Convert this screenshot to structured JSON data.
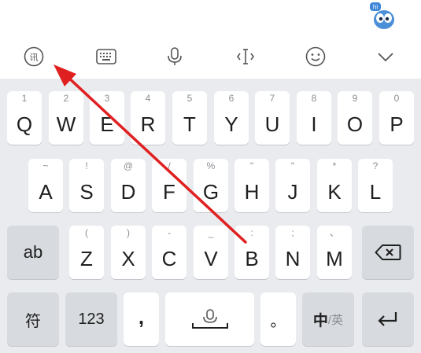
{
  "toolbar": {
    "icons": [
      "handwriting-input-icon",
      "keyboard-icon",
      "microphone-icon",
      "cursor-move-icon",
      "emoji-icon",
      "collapse-icon"
    ]
  },
  "mascot_badge": "hi",
  "rows": {
    "row1": [
      {
        "main": "Q",
        "sub": "1"
      },
      {
        "main": "W",
        "sub": "2"
      },
      {
        "main": "E",
        "sub": "3"
      },
      {
        "main": "R",
        "sub": "4"
      },
      {
        "main": "T",
        "sub": "5"
      },
      {
        "main": "Y",
        "sub": "6"
      },
      {
        "main": "U",
        "sub": "7"
      },
      {
        "main": "I",
        "sub": "8"
      },
      {
        "main": "O",
        "sub": "9"
      },
      {
        "main": "P",
        "sub": "0"
      }
    ],
    "row2": [
      {
        "main": "A",
        "sub": "~"
      },
      {
        "main": "S",
        "sub": "!"
      },
      {
        "main": "D",
        "sub": "@"
      },
      {
        "main": "F",
        "sub": "/"
      },
      {
        "main": "G",
        "sub": "%"
      },
      {
        "main": "H",
        "sub": "\""
      },
      {
        "main": "J",
        "sub": "\""
      },
      {
        "main": "K",
        "sub": "*"
      },
      {
        "main": "L",
        "sub": "?"
      }
    ],
    "row3": [
      {
        "main": "Z",
        "sub": "("
      },
      {
        "main": "X",
        "sub": ")"
      },
      {
        "main": "C",
        "sub": "-"
      },
      {
        "main": "V",
        "sub": "_"
      },
      {
        "main": "B",
        "sub": ":"
      },
      {
        "main": "N",
        "sub": ";"
      },
      {
        "main": "M",
        "sub": "、"
      }
    ]
  },
  "keys": {
    "ab": "ab",
    "symbols": "符",
    "numbers": "123",
    "comma": ",",
    "period": "。",
    "lang_main": "中",
    "lang_sep": "/英"
  },
  "colors": {
    "keyboard_bg": "#e9ebee",
    "key_bg": "#ffffff",
    "special_key_bg": "#d7dade",
    "annotation_arrow": "#e02020"
  }
}
